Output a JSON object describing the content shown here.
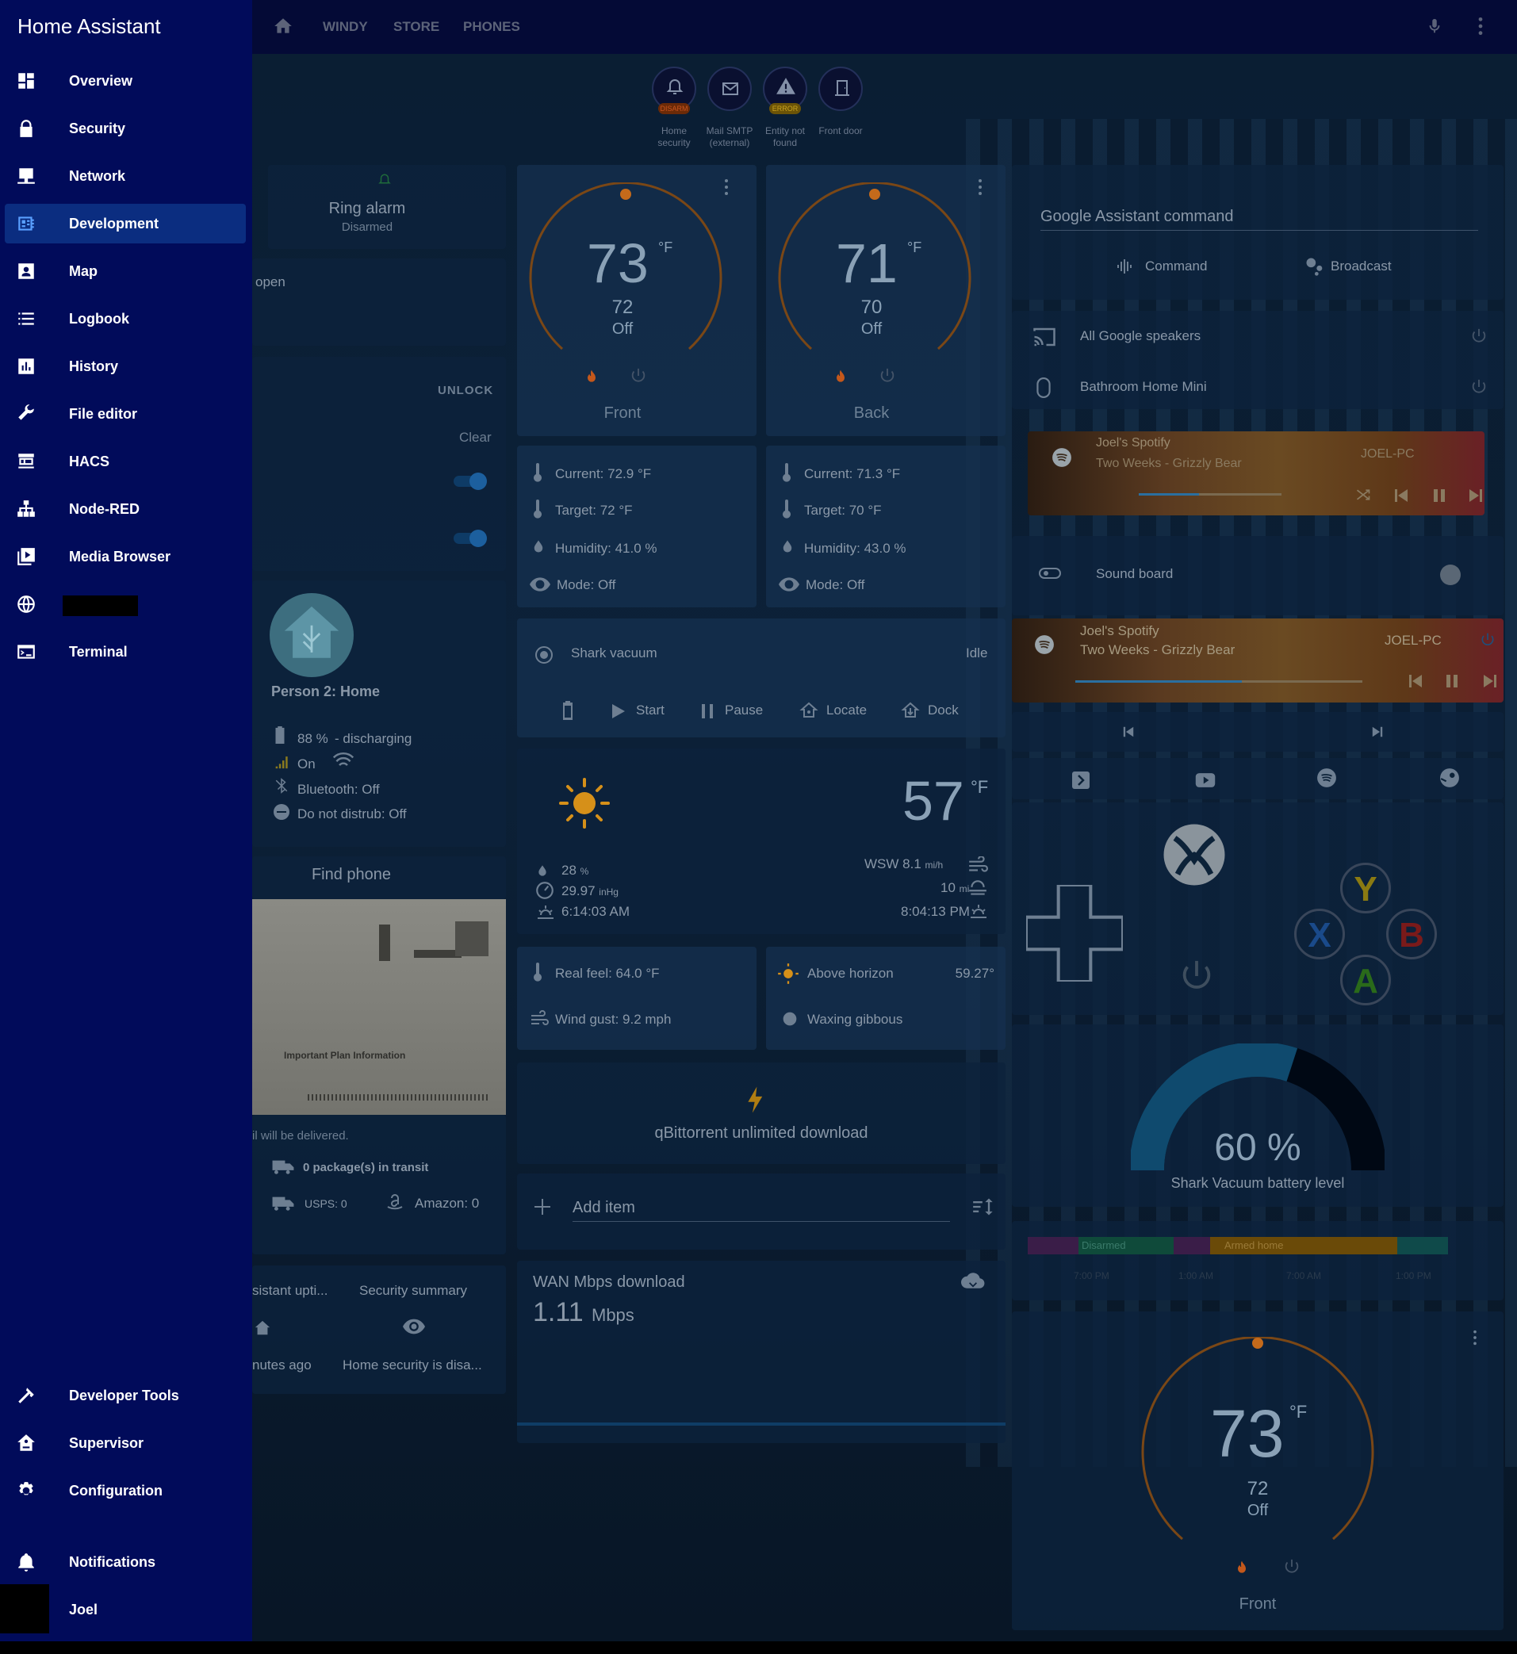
{
  "app": {
    "title": "Home Assistant"
  },
  "sidebar": {
    "items": [
      {
        "label": "Overview"
      },
      {
        "label": "Security"
      },
      {
        "label": "Network"
      },
      {
        "label": "Development"
      },
      {
        "label": "Map"
      },
      {
        "label": "Logbook"
      },
      {
        "label": "History"
      },
      {
        "label": "File editor"
      },
      {
        "label": "HACS"
      },
      {
        "label": "Node-RED"
      },
      {
        "label": "Media Browser"
      },
      {
        "label": ""
      },
      {
        "label": "Terminal"
      }
    ],
    "bottom": [
      {
        "label": "Developer Tools"
      },
      {
        "label": "Supervisor"
      },
      {
        "label": "Configuration"
      },
      {
        "label": "Notifications"
      },
      {
        "label": "Joel"
      }
    ]
  },
  "topbar": {
    "tabs": [
      "WINDY",
      "STORE",
      "PHONES"
    ]
  },
  "badges": [
    {
      "tag": "DISARM",
      "caption1": "Home",
      "caption2": "security"
    },
    {
      "tag": "",
      "caption1": "Mail SMTP",
      "caption2": "(external)"
    },
    {
      "tag": "ERROR",
      "caption1": "Entity not",
      "caption2": "found"
    },
    {
      "tag": "",
      "caption1": "Front door",
      "caption2": ""
    }
  ],
  "left": {
    "ring_title": "Ring alarm",
    "ring_state": "Disarmed",
    "open_text": "open",
    "unlock": "UNLOCK",
    "clear": "Clear",
    "person_title": "Person 2: Home",
    "battery": "88 %",
    "battery_state": "- discharging",
    "charging": "On",
    "bluetooth": "Bluetooth: Off",
    "dnd": "Do not distrub: Off",
    "find_phone": "Find phone",
    "mail_heading": "Important Plan Information",
    "mail_note": "il will be delivered.",
    "packages": "0 package(s) in transit",
    "usps": "USPS: 0",
    "amazon": "Amazon: 0",
    "assistant": "sistant upti...",
    "assistant_time": "nutes ago",
    "security_title": "Security summary",
    "security_state": "Home security is disa..."
  },
  "thermostats": [
    {
      "temp": "73",
      "unit": "°F",
      "target": "72",
      "mode": "Off",
      "name": "Front",
      "current": "Current: 72.9 °F",
      "target_line": "Target: 72 °F",
      "humidity": "Humidity: 41.0 %",
      "mode_line": "Mode: Off"
    },
    {
      "temp": "71",
      "unit": "°F",
      "target": "70",
      "mode": "Off",
      "name": "Back",
      "current": "Current: 71.3 °F",
      "target_line": "Target: 70 °F",
      "humidity": "Humidity: 43.0 %",
      "mode_line": "Mode: Off"
    }
  ],
  "vacuum": {
    "name": "Shark vacuum",
    "state": "Idle",
    "actions": [
      "Start",
      "Pause",
      "Locate",
      "Dock"
    ]
  },
  "weather": {
    "temp": "57",
    "unit": "°F",
    "humidity": "28",
    "humidity_unit": "%",
    "pressure": "29.97",
    "pressure_unit": "inHg",
    "sunrise": "6:14:03 AM",
    "wind": "WSW 8.1",
    "wind_unit": "mi/h",
    "visibility": "10",
    "visibility_unit": "mi",
    "sunset": "8:04:13 PM",
    "real_feel": "Real feel: 64.0 °F",
    "wind_gust": "Wind gust: 9.2 mph",
    "sun": "Above horizon",
    "sun_elev": "59.27°",
    "moon": "Waxing gibbous"
  },
  "qbit": {
    "label": "qBittorrent unlimited download"
  },
  "todo": {
    "add": "Add item"
  },
  "wan": {
    "title": "WAN Mbps download",
    "value": "1.11",
    "unit": "Mbps",
    "fill": 0.15
  },
  "google": {
    "placeholder": "Google Assistant command",
    "command": "Command",
    "broadcast": "Broadcast",
    "speakers": "All Google speakers",
    "mini": "Bathroom Home Mini"
  },
  "spotify1": {
    "title": "Joel's Spotify",
    "track": "Two Weeks - Grizzly Bear",
    "device": "JOEL-PC",
    "progress": 0.42
  },
  "soundboard": "Sound board",
  "spotify2": {
    "title": "Joel's Spotify",
    "track": "Two Weeks - Grizzly Bear",
    "device": "JOEL-PC",
    "progress": 0.58
  },
  "xbox": {
    "buttons": [
      "Y",
      "X",
      "B",
      "A"
    ]
  },
  "battery_gauge": {
    "value": "60 %",
    "label": "Shark Vacuum battery level",
    "fraction": 0.6
  },
  "alarm_history": {
    "segments": [
      "Disarmed",
      "Armed home"
    ],
    "times": [
      "7:00 PM",
      "1:00 AM",
      "7:00 AM",
      "1:00 PM"
    ]
  },
  "thermo3": {
    "temp": "73",
    "unit": "°F",
    "target": "72",
    "mode": "Off",
    "name": "Front"
  },
  "colors": {
    "accent": "#0b2d80",
    "sidebar": "#010b5a",
    "orange": "#c46a1b",
    "heat": "#e0651b"
  }
}
